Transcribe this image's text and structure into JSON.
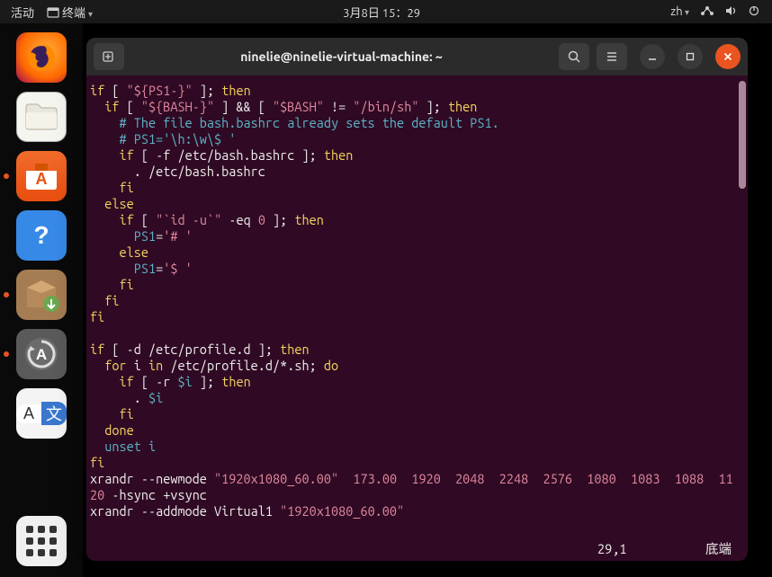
{
  "topbar": {
    "activities": "活动",
    "app": "终端",
    "datetime": "3月8日 15：29",
    "lang": "zh"
  },
  "dock": {
    "items": [
      {
        "name": "firefox-icon",
        "label": ""
      },
      {
        "name": "files-icon",
        "label": ""
      },
      {
        "name": "software-icon",
        "label": "A",
        "ind": true
      },
      {
        "name": "help-icon",
        "label": "?"
      },
      {
        "name": "package-icon",
        "label": "",
        "ind": true
      },
      {
        "name": "updater-icon",
        "label": "A",
        "ind": true
      },
      {
        "name": "input-icon",
        "la": "A",
        "lb": "文"
      },
      {
        "name": "apps-icon",
        "label": ""
      }
    ]
  },
  "window": {
    "title": "ninelie@ninelie-virtual-machine: ~"
  },
  "code": {
    "l1_a": "if",
    "l1_b": " [ ",
    "l1_c": "\"${PS1-}\"",
    "l1_d": " ]; ",
    "l1_e": "then",
    "l2_a": "  if",
    "l2_b": " [ ",
    "l2_c": "\"${BASH-}\"",
    "l2_d": " ] && [ ",
    "l2_e": "\"$BASH\"",
    "l2_f": " != ",
    "l2_g": "\"/bin/sh\"",
    "l2_h": " ]; ",
    "l2_i": "then",
    "l3": "    # The file bash.bashrc already sets the default PS1.",
    "l4": "    # PS1='\\h:\\w\\$ '",
    "l5_a": "    if",
    "l5_b": " [ -f /etc/bash.bashrc ]; ",
    "l5_c": "then",
    "l6": "      . /etc/bash.bashrc",
    "l7": "    fi",
    "l8": "  else",
    "l9_a": "    if",
    "l9_b": " [ ",
    "l9_c": "\"`id -u`\"",
    "l9_d": " -eq ",
    "l9_e": "0",
    "l9_f": " ]; ",
    "l9_g": "then",
    "l10_a": "      ",
    "l10_b": "PS1",
    "l10_c": "=",
    "l10_d": "'# '",
    "l11": "    else",
    "l12_a": "      ",
    "l12_b": "PS1",
    "l12_c": "=",
    "l12_d": "'$ '",
    "l13": "    fi",
    "l14": "  fi",
    "l15": "fi",
    "l16": "",
    "l17_a": "if",
    "l17_b": " [ -d /etc/profile.d ]; ",
    "l17_c": "then",
    "l18_a": "  for",
    "l18_b": " i ",
    "l18_c": "in",
    "l18_d": " /etc/profile.d/*.sh; ",
    "l18_e": "do",
    "l19_a": "    if",
    "l19_b": " [ -r ",
    "l19_c": "$i",
    "l19_d": " ]; ",
    "l19_e": "then",
    "l20_a": "      . ",
    "l20_b": "$i",
    "l21": "    fi",
    "l22": "  done",
    "l23_a": "  ",
    "l23_b": "unset",
    "l23_c": " ",
    "l23_d": "i",
    "l24": "fi",
    "l25_a": "xrandr --newmode ",
    "l25_b": "\"1920x1080_60.00\"",
    "l25_c": "  ",
    "l25_d": "173.00",
    "l25_e": "  ",
    "l25_f": "1920",
    "l25_g": "  ",
    "l25_h": "2048",
    "l25_i": "  ",
    "l25_j": "2248",
    "l25_k": "  ",
    "l25_l": "2576",
    "l25_m": "  ",
    "l25_n": "1080",
    "l25_o": "  ",
    "l25_p": "1083",
    "l25_q": "  ",
    "l25_r": "1088",
    "l25_s": "  ",
    "l25_t": "11",
    "l26_a": "20",
    "l26_b": " -hsync +vsync",
    "l27_a": "xrandr --addmode Virtual1 ",
    "l27_b": "\"1920x1080_60.00\""
  },
  "status": {
    "pos": "29,1",
    "loc": "底端"
  }
}
